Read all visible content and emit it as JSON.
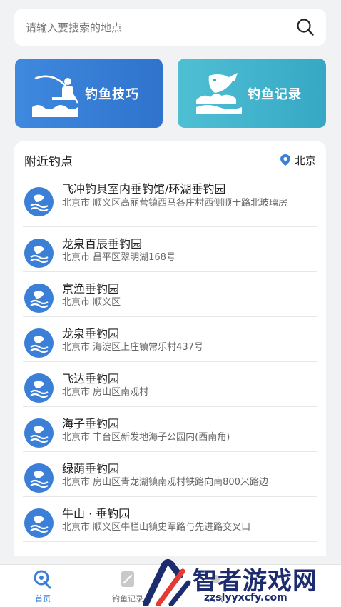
{
  "search": {
    "placeholder": "请输入要搜索的地点"
  },
  "cards": {
    "tips_label": "钓鱼技巧",
    "record_label": "钓鱼记录"
  },
  "nearby": {
    "title": "附近钓点",
    "city": "北京",
    "spots": [
      {
        "name": "飞冲钓具室内垂钓馆/环湖垂钓园",
        "address": "北京市 顺义区高丽营镇西马各庄村西侧顺于路北玻璃房"
      },
      {
        "name": "龙泉百辰垂钓园",
        "address": "北京市 昌平区翠明湖168号"
      },
      {
        "name": "京渔垂钓园",
        "address": "北京市 顺义区"
      },
      {
        "name": "龙泉垂钓园",
        "address": "北京市 海淀区上庄镇常乐村437号"
      },
      {
        "name": "飞达垂钓园",
        "address": "北京市 房山区南观村"
      },
      {
        "name": "海子垂钓园",
        "address": "北京市 丰台区新发地海子公园内(西南角)"
      },
      {
        "name": "绿荫垂钓园",
        "address": "北京市 房山区青龙湖镇南观村铁路向南800米路边"
      },
      {
        "name": "牛山 · 垂钓园",
        "address": "北京市 顺义区牛栏山镇史军路与先进路交叉口"
      }
    ]
  },
  "tabbar": {
    "tabs": [
      {
        "label": "首页"
      },
      {
        "label": "钓鱼记录"
      },
      {
        "label": "天气"
      }
    ]
  },
  "watermark": {
    "brand": "智者游戏网",
    "site": "zzslyyxcfy.com"
  },
  "colors": {
    "primary": "#3b7fd7",
    "teal": "#36a8c5",
    "background": "#f1f2f4"
  }
}
